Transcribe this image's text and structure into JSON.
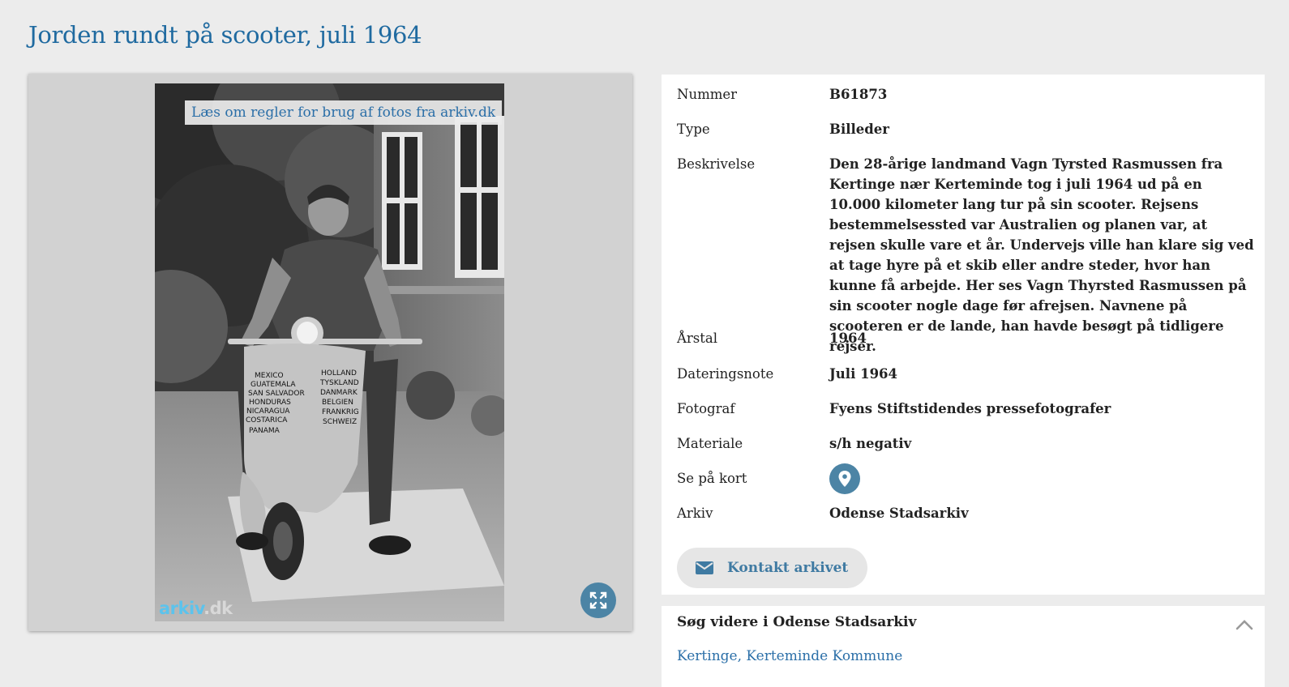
{
  "page": {
    "title": "Jorden rundt på scooter, juli 1964"
  },
  "viewer": {
    "rules_link": "Læs om regler for brug af fotos fra arkiv.dk",
    "watermark_a": "arkiv",
    "watermark_b": ".dk",
    "scooter_text_left": [
      "MEXICO",
      "GUATEMALA",
      "SAN SALVADOR",
      "HONDURAS",
      "NICARAGUA",
      "COSTARICA",
      "PANAMA"
    ],
    "scooter_text_right": [
      "HOLLAND",
      "TYSKLAND",
      "DANMARK",
      "BELGIEN",
      "FRANKRIG",
      "SCHWEIZ"
    ],
    "fullscreen_icon": "expand-icon"
  },
  "metadata": {
    "nummer_label": "Nummer",
    "nummer_value": "B61873",
    "type_label": "Type",
    "type_value": "Billeder",
    "beskrivelse_label": "Beskrivelse",
    "beskrivelse_value": "Den 28-årige landmand Vagn Tyrsted Rasmussen fra Kertinge nær Kerteminde tog i juli 1964 ud på en 10.000 kilometer lang tur på sin scooter. Rejsens bestemmelsessted var Australien og planen var, at rejsen skulle vare et år. Undervejs ville han klare sig ved at tage hyre på et skib eller andre steder, hvor han kunne få arbejde. Her ses Vagn Thyrsted Rasmussen på sin scooter nogle dage før afrejsen. Navnene på scooteren er de lande, han havde besøgt på tidligere rejser.",
    "aarstal_label": "Årstal",
    "aarstal_value": "1964",
    "dateringsnote_label": "Dateringsnote",
    "dateringsnote_value": "Juli 1964",
    "fotograf_label": "Fotograf",
    "fotograf_value": "Fyens Stiftstidendes pressefotografer",
    "materiale_label": "Materiale",
    "materiale_value": "s/h negativ",
    "kort_label": "Se på kort",
    "arkiv_label": "Arkiv",
    "arkiv_value": "Odense Stadsarkiv",
    "contact_button": "Kontakt arkivet"
  },
  "search": {
    "title": "Søg videre i Odense Stadsarkiv",
    "link": "Kertinge, Kerteminde Kommune"
  },
  "colors": {
    "accent": "#1f6aa0",
    "button_blue": "#4c84a5",
    "background": "#ececec"
  }
}
